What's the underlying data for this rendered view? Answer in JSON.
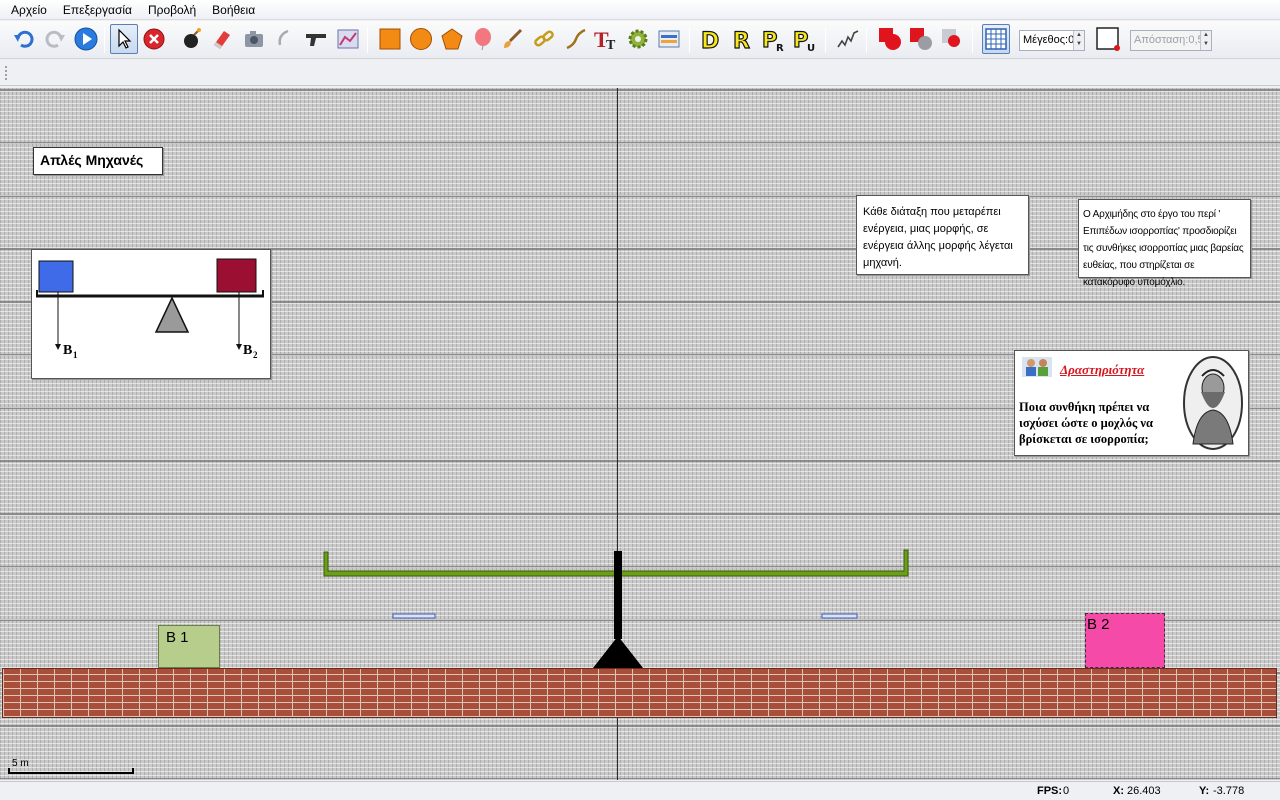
{
  "menu": [
    "Αρχείο",
    "Επεξεργασία",
    "Προβολή",
    "Βοήθεια"
  ],
  "toolbar": {
    "size_spinner": "Μέγεθος:0",
    "distance_spinner": "Απόσταση:0,5",
    "tools": [
      "undo-icon",
      "redo-icon",
      "play-icon",
      "select-icon",
      "delete-icon",
      "bomb-icon",
      "eraser-icon",
      "camera-icon",
      "hook-icon",
      "gun-icon",
      "graph-icon",
      "rectangle-icon",
      "circle-icon",
      "polygon-icon",
      "balloon-icon",
      "brush-icon",
      "chain-icon",
      "rope-icon",
      "text-icon",
      "gear-icon",
      "display-icon",
      "D-icon",
      "R-icon",
      "PR-icon",
      "PU-icon",
      "spring-icon",
      "red-shape-1-icon",
      "red-shape-2-icon",
      "red-shape-3-icon",
      "grid-icon",
      "frame-icon"
    ]
  },
  "canvas": {
    "title": "Απλές Μηχανές",
    "definition": "Κάθε διάταξη που μεταρέπει ενέργεια, μιας μορφής, σε ενέργεια άλλης μορφής λέγεται μηχανή.",
    "archimedes_note": "Ο Αρχιμήδης στο έργο του περί ' Επιπέδων ισορροπίας' προσδιορίζει τις συνθήκες ισορροπίας μιας βαρείας ευθείας, που στηρίζεται σε κατακόρυφο υπομόχλιο.",
    "activity_title": "Δραστηριότητα",
    "activity_question": "Ποια συνθήκη πρέπει να ισχύσει ώστε ο μοχλός να βρίσκεται σε ισορροπία;",
    "diagram_label_left": "B",
    "diagram_label_left_sub": "1",
    "diagram_label_right": "B",
    "diagram_label_right_sub": "2",
    "box_left_label": "B 1",
    "box_right_label": "B 2",
    "scale_label": "5 m",
    "colors": {
      "box_left": "#b6cd8b",
      "box_right": "#f64aa8",
      "lever": "#6aa018",
      "diag_blue": "#3f6ae8",
      "diag_red": "#9b0f33"
    }
  },
  "status": {
    "fps_label": "FPS:",
    "fps_value": "0",
    "x_label": "X:",
    "x_value": "26.403",
    "y_label": "Y:",
    "y_value": "-3.778"
  }
}
